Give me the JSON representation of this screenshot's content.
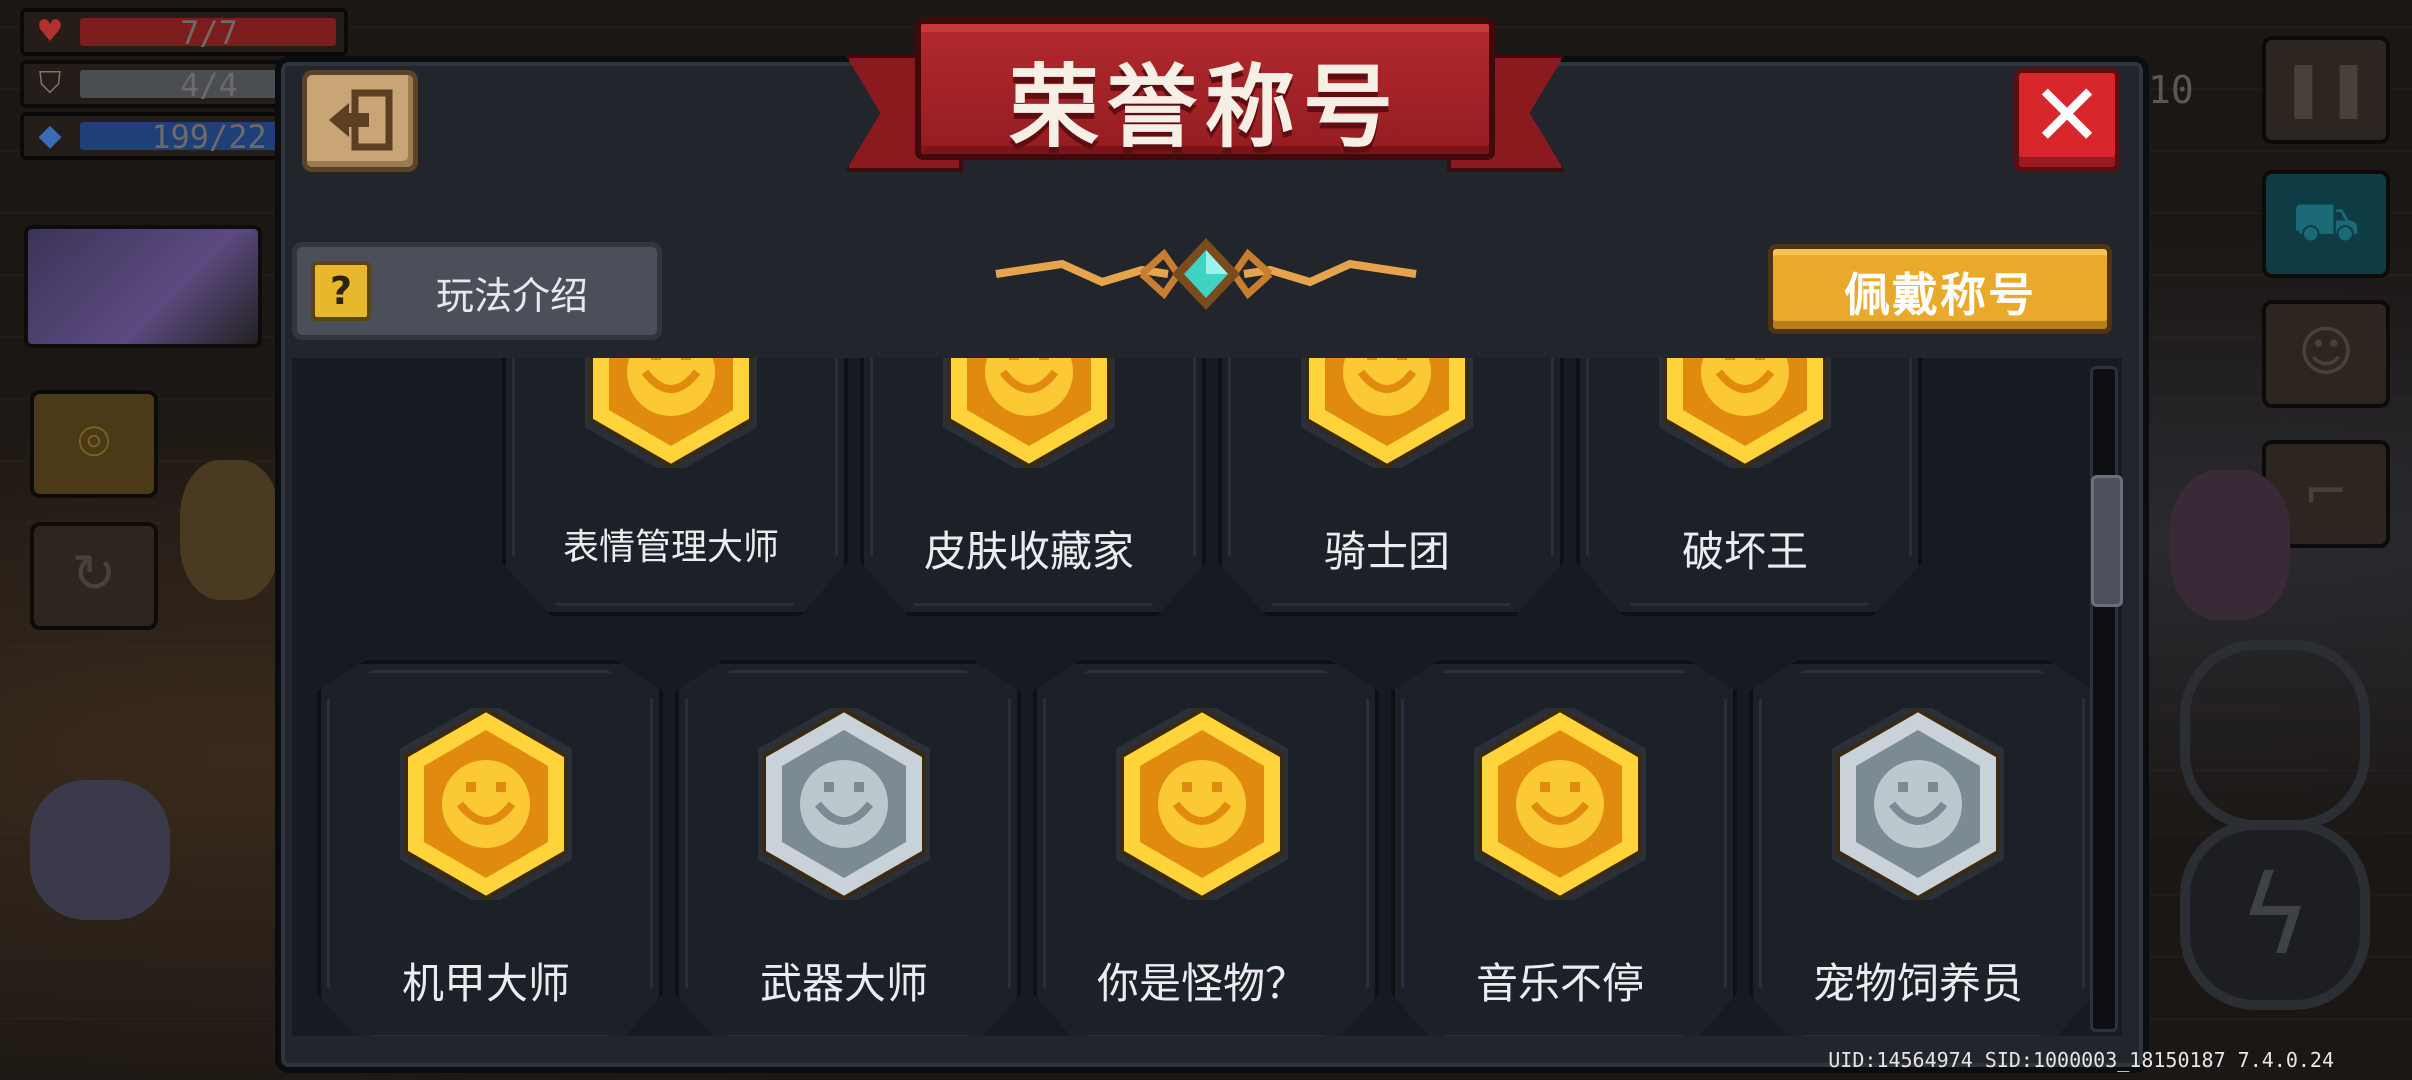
{
  "hud": {
    "hp": "7/7",
    "armor": "4/4",
    "energy": "199/22",
    "counter": "10",
    "uid_line": "UID:14564974 SID:1000003_18150187 7.4.0.24"
  },
  "dialog": {
    "title": "荣誉称号",
    "help_label": "玩法介绍",
    "help_icon_glyph": "?",
    "wear_label": "佩戴称号",
    "close_glyph": "✕"
  },
  "titles_row1": [
    {
      "name": "表情管理大师",
      "medal": "gold",
      "icon": "smile-face-icon"
    },
    {
      "name": "皮肤收藏家",
      "medal": "gold",
      "icon": "chick-icon"
    },
    {
      "name": "骑士团",
      "medal": "gold",
      "icon": "knight-helmet-icon"
    },
    {
      "name": "破坏王",
      "medal": "gold",
      "icon": "broken-crate-icon"
    }
  ],
  "titles_row2": [
    {
      "name": "机甲大师",
      "medal": "gold",
      "icon": "mech-fist-icon"
    },
    {
      "name": "武器大师",
      "medal": "silver",
      "icon": "hammer-icon"
    },
    {
      "name": "你是怪物？",
      "medal": "gold",
      "icon": "monster-icon"
    },
    {
      "name": "音乐不停",
      "medal": "gold",
      "icon": "music-sheet-icon"
    },
    {
      "name": "宠物饲养员",
      "medal": "silver",
      "icon": "pet-cat-icon"
    }
  ],
  "colors": {
    "gold_light": "#ffd43b",
    "gold_dark": "#e08a10",
    "silver_light": "#c9d2d8",
    "silver_dark": "#7c8a94",
    "ribbon": "#a5232a",
    "wear_button": "#e9a92a"
  }
}
